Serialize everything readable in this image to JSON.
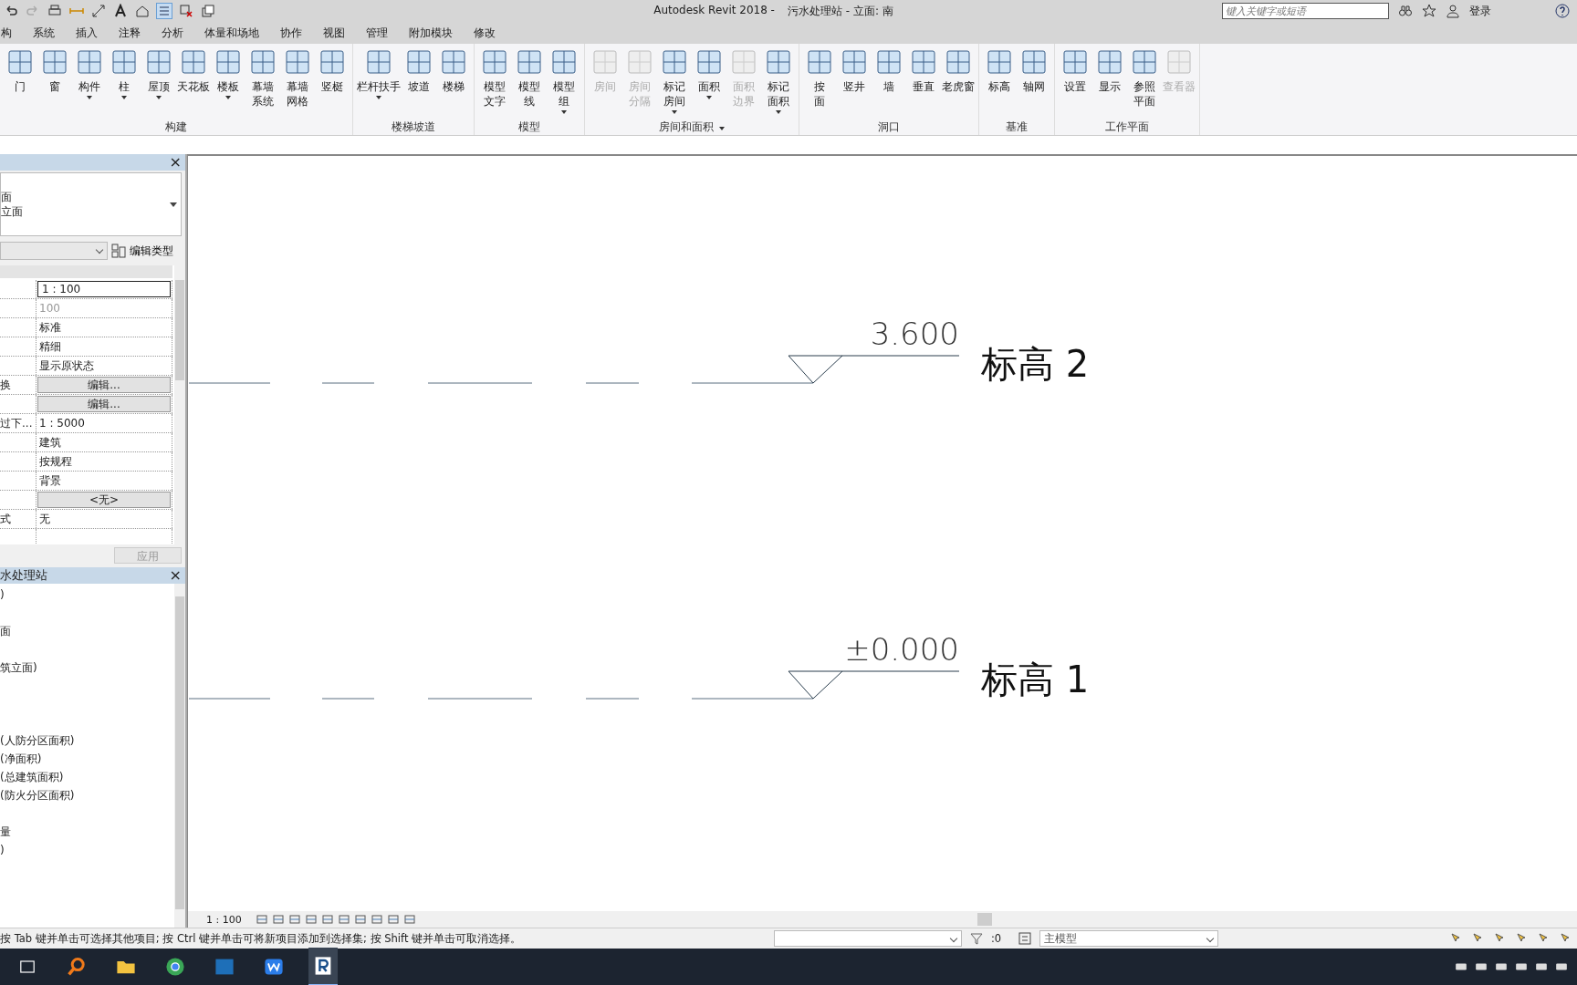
{
  "window": {
    "app_title": "Autodesk Revit 2018 -",
    "document_title": "污水处理站 - 立面: 南"
  },
  "search": {
    "placeholder": "键入关键字或短语"
  },
  "user": {
    "label": "登录"
  },
  "tabs": [
    {
      "label": "构",
      "selected": false
    },
    {
      "label": "系统",
      "selected": false
    },
    {
      "label": "插入",
      "selected": false
    },
    {
      "label": "注释",
      "selected": false
    },
    {
      "label": "分析",
      "selected": false
    },
    {
      "label": "体量和场地",
      "selected": false
    },
    {
      "label": "协作",
      "selected": false
    },
    {
      "label": "视图",
      "selected": false
    },
    {
      "label": "管理",
      "selected": false
    },
    {
      "label": "附加模块",
      "selected": false
    },
    {
      "label": "修改",
      "selected": false
    }
  ],
  "ribbon": [
    {
      "title": "构建",
      "dropdown": false,
      "tools": [
        {
          "label_lines": [
            "门"
          ],
          "disabled": false,
          "dropdown": false
        },
        {
          "label_lines": [
            "窗"
          ],
          "disabled": false,
          "dropdown": false
        },
        {
          "label_lines": [
            "构件"
          ],
          "disabled": false,
          "dropdown": true
        },
        {
          "label_lines": [
            "柱"
          ],
          "disabled": false,
          "dropdown": true
        },
        {
          "label_lines": [
            "屋顶"
          ],
          "disabled": false,
          "dropdown": true
        },
        {
          "label_lines": [
            "天花板"
          ],
          "disabled": false,
          "dropdown": false
        },
        {
          "label_lines": [
            "楼板"
          ],
          "disabled": false,
          "dropdown": true
        },
        {
          "label_lines": [
            "幕墙",
            "系统"
          ],
          "disabled": false,
          "dropdown": false
        },
        {
          "label_lines": [
            "幕墙",
            "网格"
          ],
          "disabled": false,
          "dropdown": false
        },
        {
          "label_lines": [
            "竖梃"
          ],
          "disabled": false,
          "dropdown": false
        }
      ]
    },
    {
      "title": "楼梯坡道",
      "dropdown": false,
      "tools": [
        {
          "label_lines": [
            "栏杆扶手"
          ],
          "disabled": false,
          "dropdown": true
        },
        {
          "label_lines": [
            "坡道"
          ],
          "disabled": false,
          "dropdown": false
        },
        {
          "label_lines": [
            "楼梯"
          ],
          "disabled": false,
          "dropdown": false
        }
      ]
    },
    {
      "title": "模型",
      "dropdown": false,
      "tools": [
        {
          "label_lines": [
            "模型",
            "文字"
          ],
          "disabled": false,
          "dropdown": false
        },
        {
          "label_lines": [
            "模型",
            "线"
          ],
          "disabled": false,
          "dropdown": false
        },
        {
          "label_lines": [
            "模型",
            "组"
          ],
          "disabled": false,
          "dropdown": true
        }
      ]
    },
    {
      "title": "房间和面积",
      "dropdown": true,
      "tools": [
        {
          "label_lines": [
            "房间"
          ],
          "disabled": true,
          "dropdown": false
        },
        {
          "label_lines": [
            "房间",
            "分隔"
          ],
          "disabled": true,
          "dropdown": false
        },
        {
          "label_lines": [
            "标记",
            "房间"
          ],
          "disabled": false,
          "dropdown": true
        },
        {
          "label_lines": [
            "面积"
          ],
          "disabled": false,
          "dropdown": true
        },
        {
          "label_lines": [
            "面积",
            "边界"
          ],
          "disabled": true,
          "dropdown": false
        },
        {
          "label_lines": [
            "标记",
            "面积"
          ],
          "disabled": false,
          "dropdown": true
        }
      ]
    },
    {
      "title": "洞口",
      "dropdown": false,
      "tools": [
        {
          "label_lines": [
            "按",
            "面"
          ],
          "disabled": false,
          "dropdown": false
        },
        {
          "label_lines": [
            "竖井"
          ],
          "disabled": false,
          "dropdown": false
        },
        {
          "label_lines": [
            "墙"
          ],
          "disabled": false,
          "dropdown": false
        },
        {
          "label_lines": [
            "垂直"
          ],
          "disabled": false,
          "dropdown": false
        },
        {
          "label_lines": [
            "老虎窗"
          ],
          "disabled": false,
          "dropdown": false
        }
      ]
    },
    {
      "title": "基准",
      "dropdown": false,
      "tools": [
        {
          "label_lines": [
            "标高"
          ],
          "disabled": false,
          "dropdown": false
        },
        {
          "label_lines": [
            "轴网"
          ],
          "disabled": false,
          "dropdown": false
        }
      ]
    },
    {
      "title": "工作平面",
      "dropdown": false,
      "tools": [
        {
          "label_lines": [
            "设置"
          ],
          "disabled": false,
          "dropdown": false
        },
        {
          "label_lines": [
            "显示"
          ],
          "disabled": false,
          "dropdown": false
        },
        {
          "label_lines": [
            "参照",
            "平面"
          ],
          "disabled": false,
          "dropdown": false
        },
        {
          "label_lines": [
            "查看器"
          ],
          "disabled": true,
          "dropdown": false
        }
      ]
    }
  ],
  "properties": {
    "close": "×",
    "type_lines": [
      "面",
      "立面"
    ],
    "edit_type": "编辑类型",
    "apply": "应用",
    "apply_disabled": true,
    "rows": [
      {
        "kind": "input",
        "value": "1 : 100"
      },
      {
        "kind": "grey",
        "value": "100"
      },
      {
        "kind": "text",
        "value": "标准"
      },
      {
        "kind": "text",
        "value": "精细"
      },
      {
        "kind": "text",
        "value": "显示原状态"
      },
      {
        "kind": "button",
        "name": "换",
        "value": "编辑..."
      },
      {
        "kind": "button",
        "value": "编辑..."
      },
      {
        "kind": "text",
        "name": "过下...",
        "value": "1 : 5000"
      },
      {
        "kind": "text",
        "value": "建筑"
      },
      {
        "kind": "text",
        "value": "按规程"
      },
      {
        "kind": "text",
        "value": "背景"
      },
      {
        "kind": "button",
        "value": "<无>"
      },
      {
        "kind": "text",
        "name": "式",
        "value": "无"
      }
    ]
  },
  "browser": {
    "title": "水处理站",
    "close": "×",
    "items": [
      ")",
      "面",
      "筑立面)",
      "(人防分区面积)",
      "(净面积)",
      "(总建筑面积)",
      "(防火分区面积)",
      "量",
      ")"
    ]
  },
  "levels": [
    {
      "elevation": "3.600",
      "name": "标高 2"
    },
    {
      "elevation": "±0.000",
      "name": "标高 1"
    }
  ],
  "view_bar": {
    "scale": "1 : 100"
  },
  "status_bar": {
    "message": "按 Tab 键并单击可选择其他项目; 按 Ctrl 键并单击可将新项目添加到选择集; 按 Shift 键并单击可取消选择。",
    "filter_count": ":0",
    "model": "主模型"
  }
}
